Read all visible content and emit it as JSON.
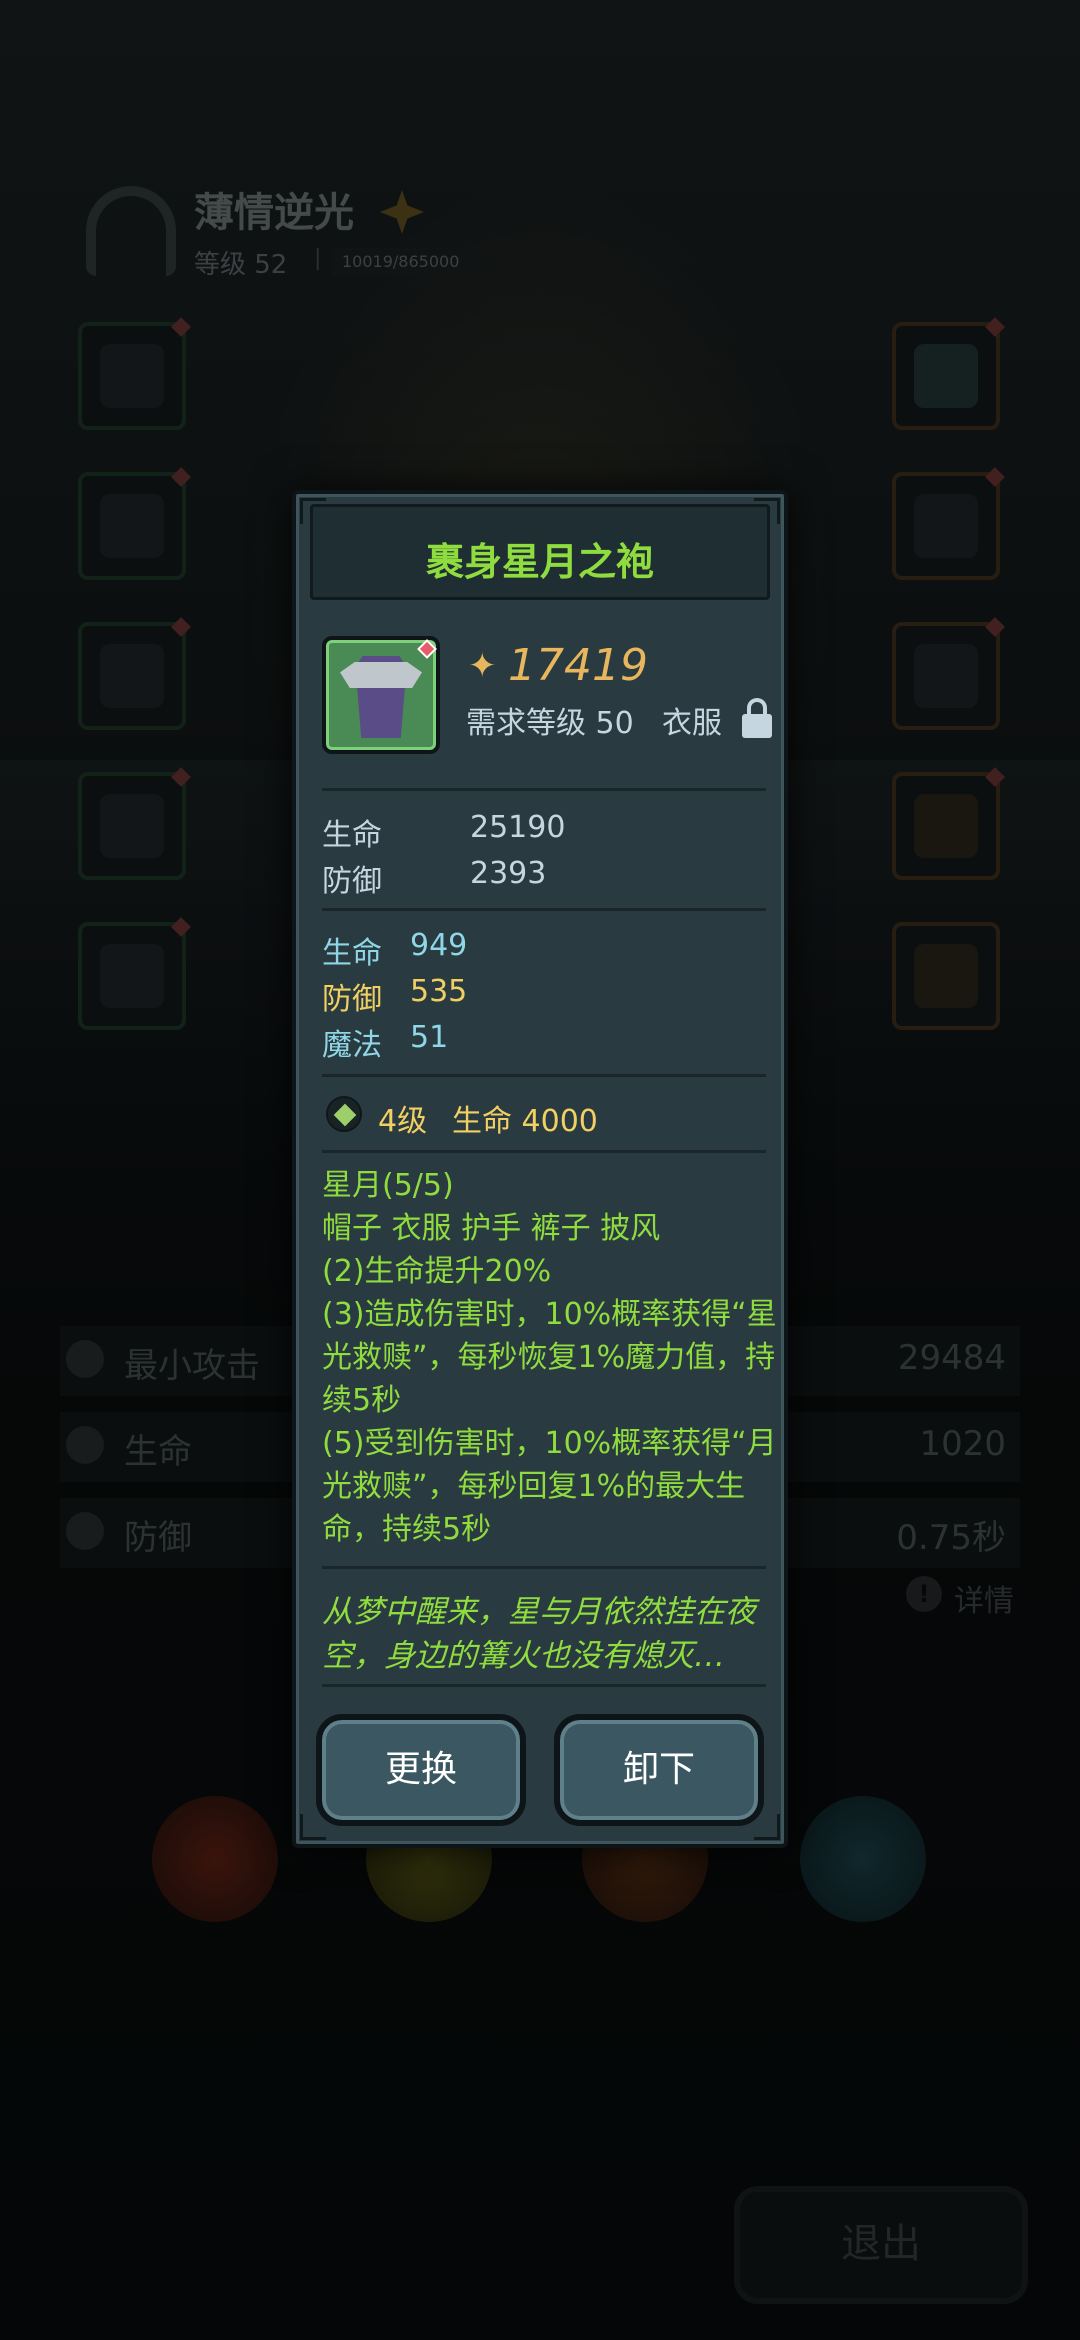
{
  "hero": {
    "name": "薄情逆光",
    "level": "等级 52",
    "separator": "|",
    "exp": "10019/865000"
  },
  "stats_panel": {
    "rows": [
      {
        "label": "最小攻击",
        "value": "29484"
      },
      {
        "label": "生命",
        "value": "1020"
      },
      {
        "label": "防御",
        "value": "0.75秒"
      }
    ],
    "detail_label": "详情",
    "detail_icon": "!"
  },
  "exit_label": "退出",
  "item_dialog": {
    "title": "裹身星月之袍",
    "power_icon": "🗡",
    "power": "17419",
    "required_level": "需求等级 50",
    "type": "衣服",
    "base_stats": [
      {
        "label": "生命",
        "value": "25190"
      },
      {
        "label": "防御",
        "value": "2393"
      }
    ],
    "bonus_stats": [
      {
        "label": "生命",
        "value": "949",
        "color": "#8fd6e6"
      },
      {
        "label": "防御",
        "value": "535",
        "color": "#f0d062"
      },
      {
        "label": "魔法",
        "value": "51",
        "color": "#8fd6e6"
      }
    ],
    "gem": {
      "level": "4级",
      "stat": "生命 4000"
    },
    "set": {
      "name": "星月(5/5)",
      "pieces": "帽子 衣服 护手 裤子 披风",
      "effect_2": "(2)生命提升20%",
      "effect_3": "(3)造成伤害时，10%概率获得“星光救赎”，每秒恢复1%魔力值，持续5秒",
      "effect_5": "(5)受到伤害时，10%概率获得“月光救赎”，每秒回复1%的最大生命，持续5秒"
    },
    "flavor": "从梦中醒来，星与月依然挂在夜空，身边的篝火也没有熄灭…",
    "buttons": {
      "replace": "更换",
      "unequip": "卸下"
    }
  },
  "colors": {
    "title_green": "#8fdc3f",
    "power_gold": "#e7b65d",
    "dialog_bg": "#293a40"
  }
}
